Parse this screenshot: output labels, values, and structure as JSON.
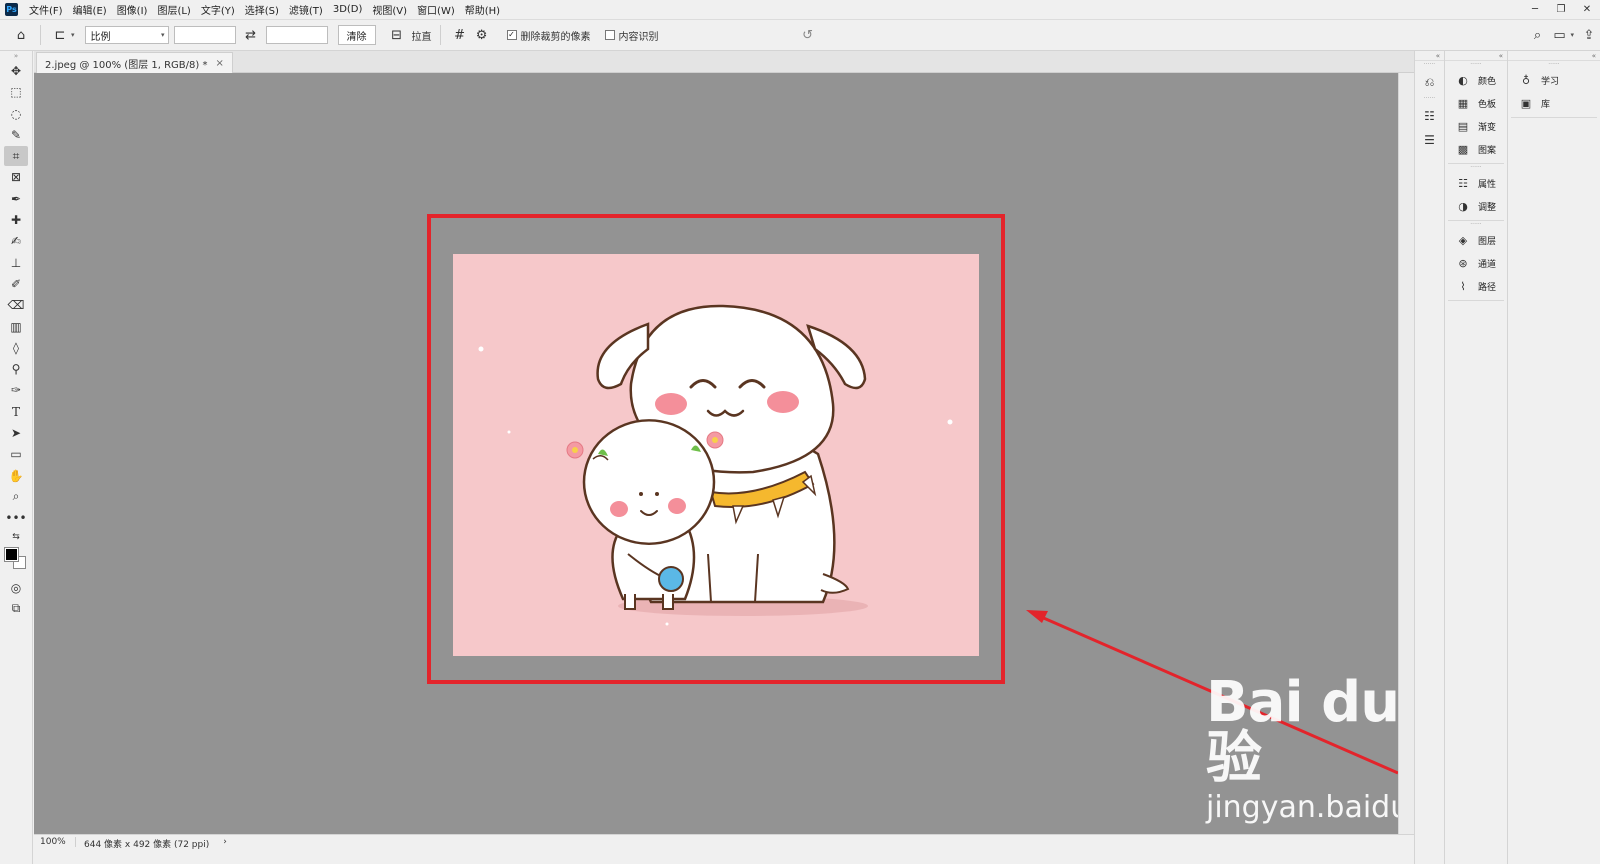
{
  "app": {
    "logo": "Ps"
  },
  "menu": [
    "文件(F)",
    "编辑(E)",
    "图像(I)",
    "图层(L)",
    "文字(Y)",
    "选择(S)",
    "滤镜(T)",
    "3D(D)",
    "视图(V)",
    "窗口(W)",
    "帮助(H)"
  ],
  "window_controls": {
    "minimize": "─",
    "restore": "❐",
    "close": "✕"
  },
  "options_bar": {
    "ratio_select": "比例",
    "width_value": "",
    "height_value": "",
    "clear_label": "清除",
    "straighten_label": "拉直",
    "delete_cropped_label": "删除裁剪的像素",
    "delete_cropped_checked": true,
    "content_aware_label": "内容识别",
    "content_aware_checked": false
  },
  "document": {
    "tab_title": "2.jpeg @ 100% (图层 1, RGB/8) *",
    "close": "×"
  },
  "status": {
    "zoom": "100%",
    "info": "644 像素 x 492 像素 (72 ppi)",
    "arrow": "›"
  },
  "tools": [
    "move-icon",
    "marquee-icon",
    "lasso-icon",
    "quick-select-icon",
    "crop-icon",
    "frame-icon",
    "eyedropper-icon",
    "healing-icon",
    "brush-icon",
    "stamp-icon",
    "history-brush-icon",
    "eraser-icon",
    "gradient-icon",
    "blur-icon",
    "dodge-icon",
    "pen-icon",
    "type-icon",
    "path-select-icon",
    "rectangle-icon",
    "hand-icon",
    "zoom-icon",
    "more-icon"
  ],
  "panels": {
    "group1": [
      {
        "icon": "color-icon",
        "label": "颜色"
      },
      {
        "icon": "swatches-icon",
        "label": "色板"
      },
      {
        "icon": "gradient-panel-icon",
        "label": "渐变"
      },
      {
        "icon": "pattern-icon",
        "label": "图案"
      }
    ],
    "group2": [
      {
        "icon": "properties-icon",
        "label": "属性"
      },
      {
        "icon": "adjustments-icon",
        "label": "调整"
      }
    ],
    "group3": [
      {
        "icon": "layers-icon",
        "label": "图层"
      },
      {
        "icon": "channels-icon",
        "label": "通道"
      },
      {
        "icon": "paths-icon",
        "label": "路径"
      }
    ],
    "group4": [
      {
        "icon": "learn-icon",
        "label": "学习"
      },
      {
        "icon": "libraries-icon",
        "label": "库"
      }
    ]
  },
  "watermark": {
    "logo": "Bai du 经验",
    "url": "jingyan.baidu.com"
  },
  "colors": {
    "crop_highlight": "#e3242b",
    "canvas_bg": "#939393",
    "image_bg": "#f6c8ca"
  }
}
